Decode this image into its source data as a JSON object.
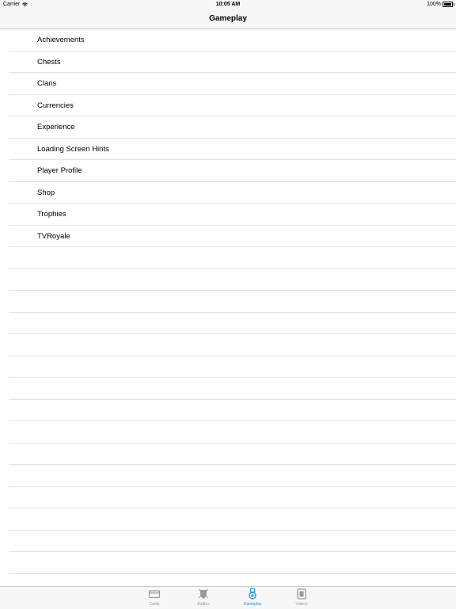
{
  "status": {
    "carrier": "Carrier",
    "time": "10:05 AM",
    "battery": "100%"
  },
  "nav": {
    "title": "Gameplay"
  },
  "list": {
    "items": [
      "Achievements",
      "Chests",
      "Clans",
      "Currencies",
      "Experience",
      "Loading Screen Hints",
      "Player Profile",
      "Shop",
      "Trophies",
      "TVRoyale"
    ]
  },
  "tabbar": {
    "tabs": [
      {
        "label": "Cards",
        "icon": "cards-icon"
      },
      {
        "label": "Battles",
        "icon": "battles-icon"
      },
      {
        "label": "Gameplay",
        "icon": "gameplay-icon",
        "selected": true
      },
      {
        "label": "Videos",
        "icon": "videos-icon"
      }
    ],
    "active_color": "#1e90e6",
    "inactive_color": "#999999"
  }
}
